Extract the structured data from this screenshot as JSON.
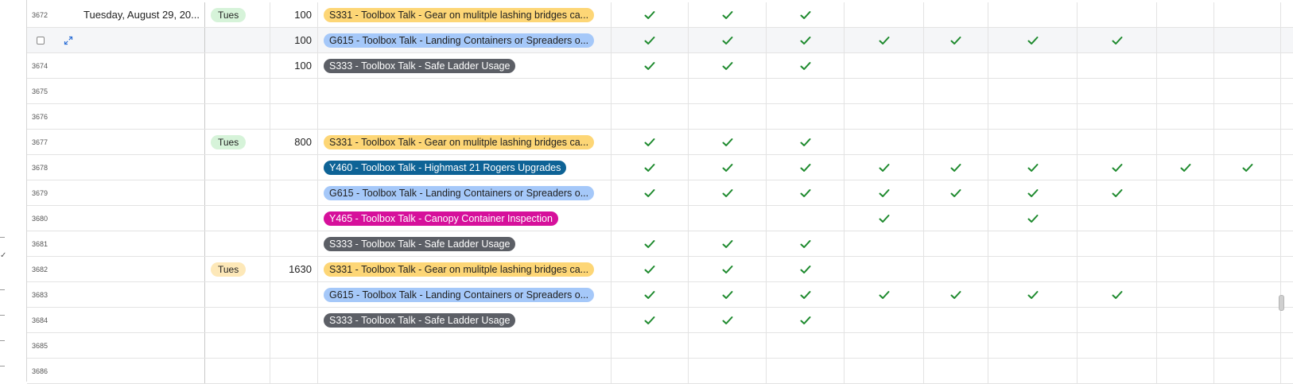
{
  "colors": {
    "check": "#1e8a2e",
    "grid_line": "#e3e3e3",
    "selected_row_bg": "#f5f6f8"
  },
  "icons": {
    "check": "check-icon",
    "expand": "expand-icon",
    "row_select": "row-select-checkbox"
  },
  "rows": [
    {
      "num": "3672",
      "date": "Tuesday, August 29, 20...",
      "day": "Tues",
      "day_color": "#d6f3d9",
      "time": "100",
      "talk": "S331 - Toolbox Talk - Gear on mulitple lashing bridges ca...",
      "talk_bg": "#fdd676",
      "talk_fg": "#1f1f1f",
      "checks": [
        1,
        1,
        1,
        0,
        0,
        0,
        0,
        0,
        0
      ]
    },
    {
      "num": "",
      "date": "",
      "day": "",
      "day_color": "",
      "time": "100",
      "talk": "G615 - Toolbox Talk - Landing Containers or Spreaders o...",
      "talk_bg": "#a5c8f9",
      "talk_fg": "#1f1f1f",
      "checks": [
        1,
        1,
        1,
        1,
        1,
        1,
        1,
        0,
        0
      ],
      "selected": true
    },
    {
      "num": "3674",
      "date": "",
      "day": "",
      "day_color": "",
      "time": "100",
      "talk": "S333 - Toolbox Talk - Safe Ladder Usage",
      "talk_bg": "#5c5f66",
      "talk_fg": "#ffffff",
      "checks": [
        1,
        1,
        1,
        0,
        0,
        0,
        0,
        0,
        0
      ]
    },
    {
      "num": "3675",
      "date": "",
      "day": "",
      "day_color": "",
      "time": "",
      "talk": "",
      "talk_bg": "",
      "talk_fg": "",
      "checks": [
        0,
        0,
        0,
        0,
        0,
        0,
        0,
        0,
        0
      ]
    },
    {
      "num": "3676",
      "date": "",
      "day": "",
      "day_color": "",
      "time": "",
      "talk": "",
      "talk_bg": "",
      "talk_fg": "",
      "checks": [
        0,
        0,
        0,
        0,
        0,
        0,
        0,
        0,
        0
      ]
    },
    {
      "num": "3677",
      "date": "",
      "day": "Tues",
      "day_color": "#d6f3d9",
      "time": "800",
      "talk": "S331 - Toolbox Talk - Gear on mulitple lashing bridges ca...",
      "talk_bg": "#fdd676",
      "talk_fg": "#1f1f1f",
      "checks": [
        1,
        1,
        1,
        0,
        0,
        0,
        0,
        0,
        0
      ]
    },
    {
      "num": "3678",
      "date": "",
      "day": "",
      "day_color": "",
      "time": "",
      "talk": "Y460 - Toolbox Talk - Highmast 21 Rogers Upgrades",
      "talk_bg": "#0e6396",
      "talk_fg": "#ffffff",
      "checks": [
        1,
        1,
        1,
        1,
        1,
        1,
        1,
        1,
        1
      ]
    },
    {
      "num": "3679",
      "date": "",
      "day": "",
      "day_color": "",
      "time": "",
      "talk": "G615 - Toolbox Talk - Landing Containers or Spreaders o...",
      "talk_bg": "#a5c8f9",
      "talk_fg": "#1f1f1f",
      "checks": [
        1,
        1,
        1,
        1,
        1,
        1,
        1,
        0,
        0
      ]
    },
    {
      "num": "3680",
      "date": "",
      "day": "",
      "day_color": "",
      "time": "",
      "talk": "Y465 - Toolbox Talk - Canopy Container Inspection",
      "talk_bg": "#d6109b",
      "talk_fg": "#ffffff",
      "checks": [
        0,
        0,
        0,
        1,
        0,
        1,
        0,
        0,
        0
      ]
    },
    {
      "num": "3681",
      "date": "",
      "day": "",
      "day_color": "",
      "time": "",
      "talk": "S333 - Toolbox Talk - Safe Ladder Usage",
      "talk_bg": "#5c5f66",
      "talk_fg": "#ffffff",
      "checks": [
        1,
        1,
        1,
        0,
        0,
        0,
        0,
        0,
        0
      ]
    },
    {
      "num": "3682",
      "date": "",
      "day": "Tues",
      "day_color": "#fde8b8",
      "time": "1630",
      "talk": "S331 - Toolbox Talk - Gear on mulitple lashing bridges ca...",
      "talk_bg": "#fdd676",
      "talk_fg": "#1f1f1f",
      "checks": [
        1,
        1,
        1,
        0,
        0,
        0,
        0,
        0,
        0
      ]
    },
    {
      "num": "3683",
      "date": "",
      "day": "",
      "day_color": "",
      "time": "",
      "talk": "G615 - Toolbox Talk - Landing Containers or Spreaders o...",
      "talk_bg": "#a5c8f9",
      "talk_fg": "#1f1f1f",
      "checks": [
        1,
        1,
        1,
        1,
        1,
        1,
        1,
        0,
        0
      ]
    },
    {
      "num": "3684",
      "date": "",
      "day": "",
      "day_color": "",
      "time": "",
      "talk": "S333 - Toolbox Talk - Safe Ladder Usage",
      "talk_bg": "#5c5f66",
      "talk_fg": "#ffffff",
      "checks": [
        1,
        1,
        1,
        0,
        0,
        0,
        0,
        0,
        0
      ]
    },
    {
      "num": "3685",
      "date": "",
      "day": "",
      "day_color": "",
      "time": "",
      "talk": "",
      "talk_bg": "",
      "talk_fg": "",
      "checks": [
        0,
        0,
        0,
        0,
        0,
        0,
        0,
        0,
        0
      ]
    },
    {
      "num": "3686",
      "date": "",
      "day": "",
      "day_color": "",
      "time": "",
      "talk": "",
      "talk_bg": "",
      "talk_fg": "",
      "checks": [
        0,
        0,
        0,
        0,
        0,
        0,
        0,
        0,
        0
      ]
    }
  ]
}
